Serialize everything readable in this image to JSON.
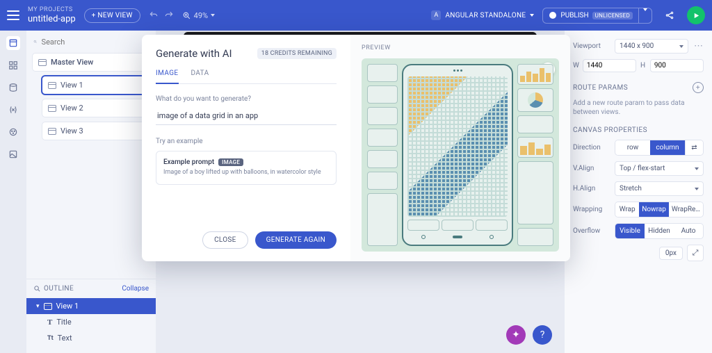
{
  "topbar": {
    "projects_label": "MY PROJECTS",
    "project_name": "untitled-app",
    "new_view": "+ NEW VIEW",
    "zoom": "49%",
    "framework": "ANGULAR STANDALONE",
    "publish": "PUBLISH",
    "license": "UNLICENSED"
  },
  "search": {
    "placeholder": "Search"
  },
  "views": {
    "master": "Master View",
    "items": [
      "View 1",
      "View 2",
      "View 3"
    ]
  },
  "outline": {
    "header": "OUTLINE",
    "collapse": "Collapse",
    "root": "View 1",
    "children": [
      "Title",
      "Text"
    ]
  },
  "modal": {
    "title": "Generate with AI",
    "credits": "18 CREDITS REMAINING",
    "tabs": {
      "image": "IMAGE",
      "data": "DATA"
    },
    "prompt_label": "What do you want to generate?",
    "prompt_value": "image of a data grid in an app",
    "try_label": "Try an example",
    "example_title": "Example prompt",
    "example_badge": "IMAGE",
    "example_body": "Image of a boy lifted up with balloons, in watercolor style",
    "close": "CLOSE",
    "generate": "GENERATE AGAIN",
    "preview": "PREVIEW"
  },
  "right": {
    "viewport_label": "Viewport",
    "viewport_value": "1440 x 900",
    "w_label": "W",
    "w_value": "1440",
    "h_label": "H",
    "h_value": "900",
    "route_header": "ROUTE PARAMS",
    "route_hint": "Add a new route param to pass data between views.",
    "canvas_header": "CANVAS PROPERTIES",
    "direction_label": "Direction",
    "dir_row": "row",
    "dir_col": "column",
    "valign_label": "V.Align",
    "valign_value": "Top / flex-start",
    "halign_label": "H.Align",
    "halign_value": "Stretch",
    "wrap_label": "Wrapping",
    "wrap_wrap": "Wrap",
    "wrap_nowrap": "Nowrap",
    "wrap_rev": "WrapRe…",
    "overflow_label": "Overflow",
    "ov_visible": "Visible",
    "ov_hidden": "Hidden",
    "ov_auto": "Auto",
    "gap_value": "0px"
  }
}
